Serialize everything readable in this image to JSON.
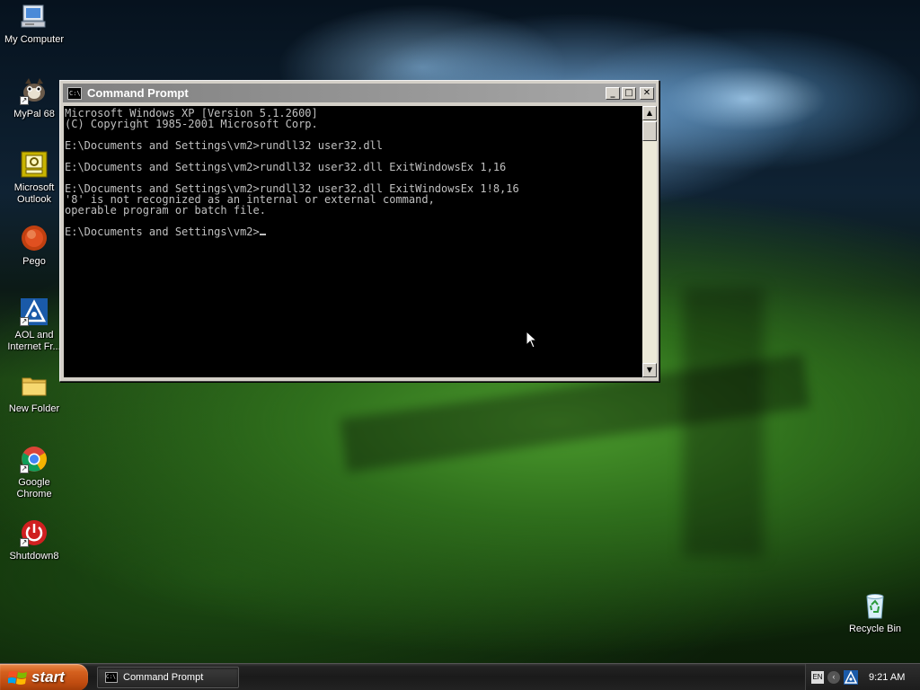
{
  "desktop": {
    "icons": [
      {
        "label": "My Computer",
        "icon": "my-computer-icon"
      },
      {
        "label": "MyPal 68",
        "icon": "mypal-icon"
      },
      {
        "label": "Microsoft Outlook",
        "icon": "outlook-icon"
      },
      {
        "label": "Pego",
        "icon": "pego-icon"
      },
      {
        "label": "AOL and Internet Fr...",
        "icon": "aol-icon"
      },
      {
        "label": "New Folder",
        "icon": "folder-icon"
      },
      {
        "label": "Google Chrome",
        "icon": "chrome-icon"
      },
      {
        "label": "Shutdown8",
        "icon": "power-icon"
      },
      {
        "label": "Recycle Bin",
        "icon": "recycle-bin-icon"
      }
    ]
  },
  "window": {
    "title": "Command Prompt",
    "icon_text": "C:\\",
    "buttons": {
      "minimize": "_",
      "maximize": "□",
      "close": "✕"
    },
    "console_lines": [
      "Microsoft Windows XP [Version 5.1.2600]",
      "(C) Copyright 1985-2001 Microsoft Corp.",
      "",
      "E:\\Documents and Settings\\vm2>rundll32 user32.dll",
      "",
      "E:\\Documents and Settings\\vm2>rundll32 user32.dll ExitWindowsEx 1,16",
      "",
      "E:\\Documents and Settings\\vm2>rundll32 user32.dll ExitWindowsEx 1!8,16",
      "'8' is not recognized as an internal or external command,",
      "operable program or batch file.",
      "",
      "E:\\Documents and Settings\\vm2>"
    ],
    "scroll": {
      "up": "▲",
      "down": "▼"
    }
  },
  "taskbar": {
    "start_label": "start",
    "task_label": "Command Prompt",
    "task_icon_text": "C:\\",
    "tray_lang": "EN",
    "tray_chevron": "‹",
    "clock": "9:21 AM"
  },
  "colors": {
    "console_bg": "#000000",
    "console_fg": "#c0c0c0",
    "start_button": "#c04c10",
    "taskbar": "#1a1a1a"
  }
}
